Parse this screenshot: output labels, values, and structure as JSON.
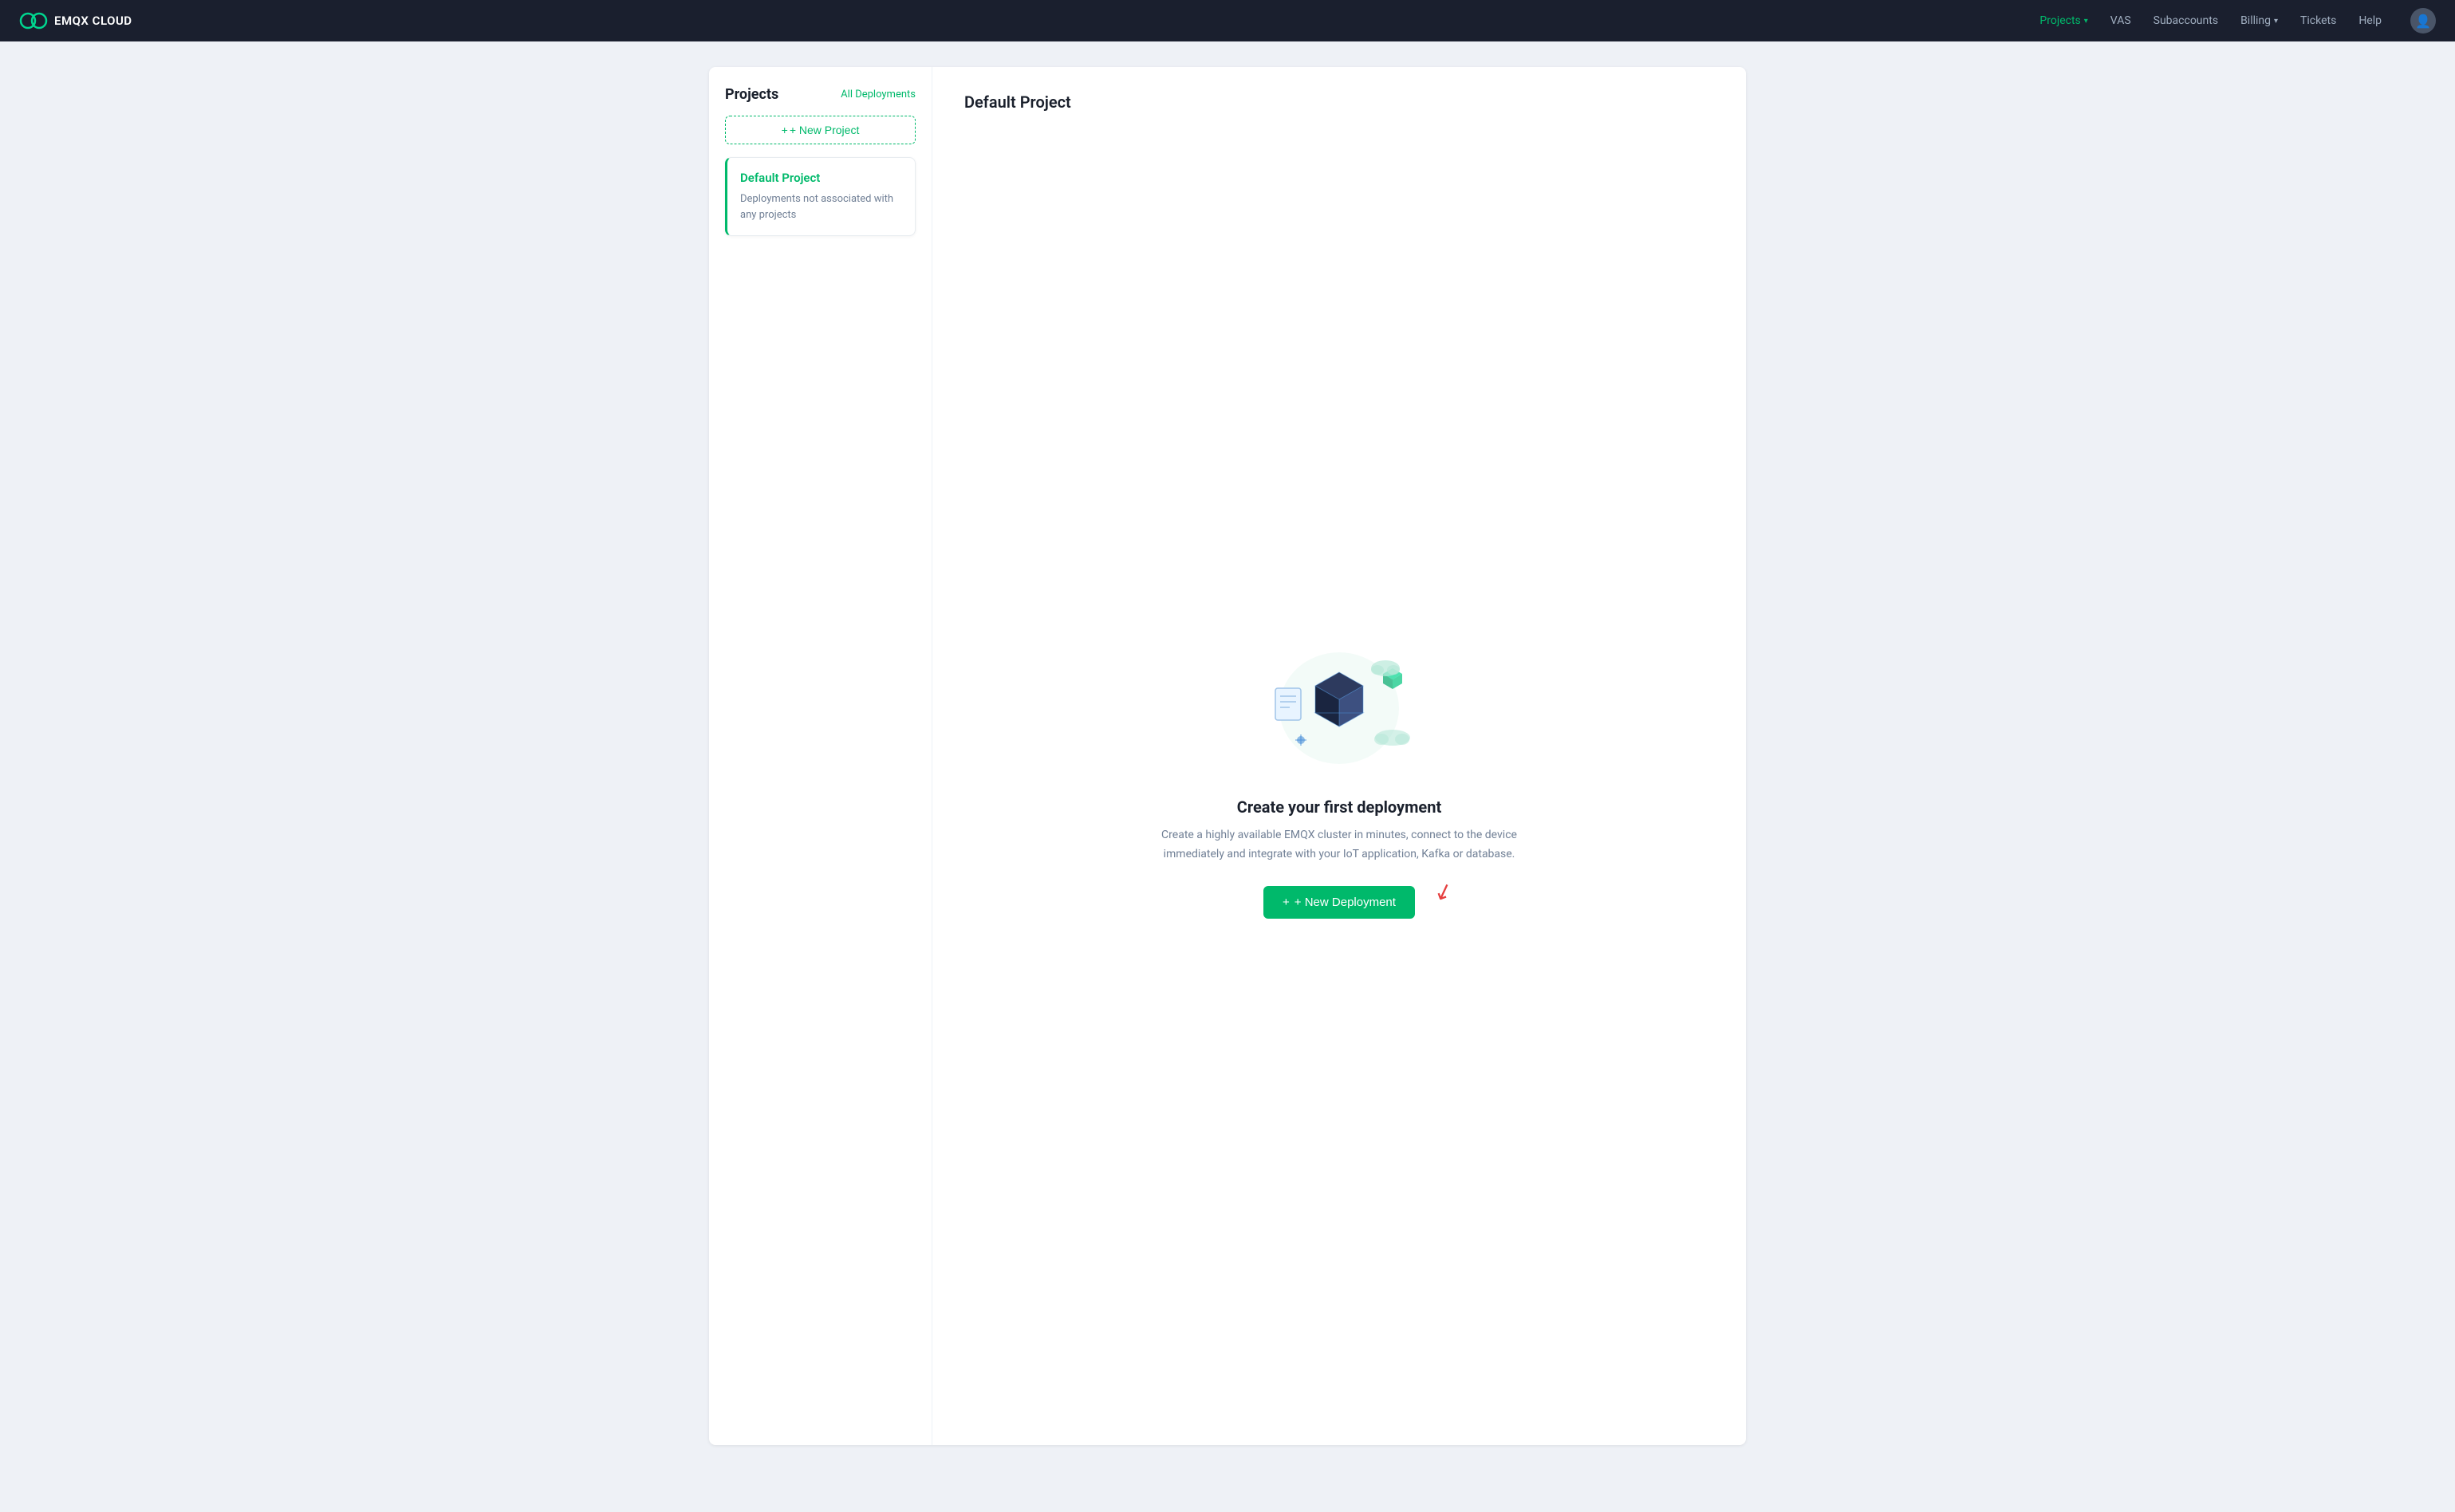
{
  "brand": {
    "name": "EMQX CLOUD"
  },
  "navbar": {
    "items": [
      {
        "label": "Projects",
        "active": true,
        "hasDropdown": true
      },
      {
        "label": "VAS",
        "active": false,
        "hasDropdown": false
      },
      {
        "label": "Subaccounts",
        "active": false,
        "hasDropdown": false
      },
      {
        "label": "Billing",
        "active": false,
        "hasDropdown": true
      },
      {
        "label": "Tickets",
        "active": false,
        "hasDropdown": false
      },
      {
        "label": "Help",
        "active": false,
        "hasDropdown": false
      }
    ]
  },
  "sidebar": {
    "title": "Projects",
    "all_deployments_label": "All Deployments",
    "new_project_label": "+ New Project",
    "project": {
      "name": "Default Project",
      "description": "Deployments not associated with any projects"
    }
  },
  "main": {
    "title": "Default Project",
    "empty_state": {
      "heading": "Create your first deployment",
      "description": "Create a highly available EMQX cluster in minutes, connect to the device immediately and integrate with your IoT application, Kafka or database.",
      "button_label": "+ New Deployment"
    }
  }
}
